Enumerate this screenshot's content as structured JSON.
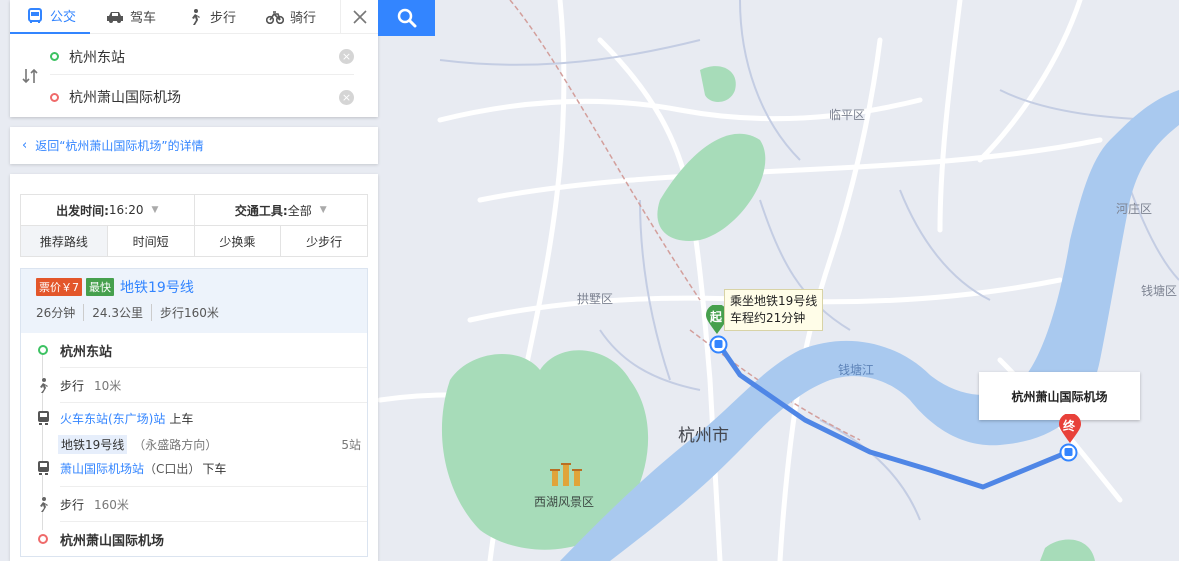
{
  "modes": [
    {
      "label": "公交",
      "icon": "bus-icon",
      "active": true
    },
    {
      "label": "驾车",
      "icon": "car-icon",
      "active": false
    },
    {
      "label": "步行",
      "icon": "walk-icon",
      "active": false
    },
    {
      "label": "骑行",
      "icon": "bike-icon",
      "active": false
    }
  ],
  "route": {
    "from": "杭州东站",
    "to": "杭州萧山国际机场"
  },
  "back_link": "返回“杭州萧山国际机场”的详情",
  "filters": {
    "depart_label": "出发时间:",
    "depart_value": "16:20",
    "transport_label": "交通工具:",
    "transport_value": "全部"
  },
  "sort_tabs": [
    "推荐路线",
    "时间短",
    "少换乘",
    "少步行"
  ],
  "plan": {
    "price_tag": "票价￥7",
    "fast_tag": "最快",
    "line_name": "地铁19号线",
    "duration": "26分钟",
    "distance": "24.3公里",
    "walk": "步行160米"
  },
  "steps": {
    "start": "杭州东站",
    "walk1_label": "步行",
    "walk1_dist": "10米",
    "board_station": "火车东站(东广场)站",
    "board_action": "上车",
    "line_chip": "地铁19号线",
    "direction": "（永盛路方向）",
    "stop_count": "5站",
    "alight_station": "萧山国际机场站",
    "alight_exit": "（C口出）",
    "alight_action": "下车",
    "walk2_label": "步行",
    "walk2_dist": "160米",
    "end": "杭州萧山国际机场"
  },
  "map": {
    "labels": {
      "linping": "临平区",
      "gongshu": "拱墅区",
      "hangzhou": "杭州市",
      "qiantang_river": "钱塘江",
      "xihu": "西湖风景区",
      "hezhuang": "河庄区",
      "qiantang": "钱塘区"
    },
    "tooltip_line1": "乘坐地铁19号线",
    "tooltip_line2": "车程约21分钟",
    "start_marker": "起",
    "end_marker": "终",
    "dest_box": "杭州萧山国际机场"
  },
  "colors": {
    "accent": "#3385ff",
    "route": "#4f86e6",
    "price_tag": "#e3562a",
    "fast_tag": "#46a04d",
    "river": "#a9c9ef",
    "greenery": "#9fd9b3"
  }
}
